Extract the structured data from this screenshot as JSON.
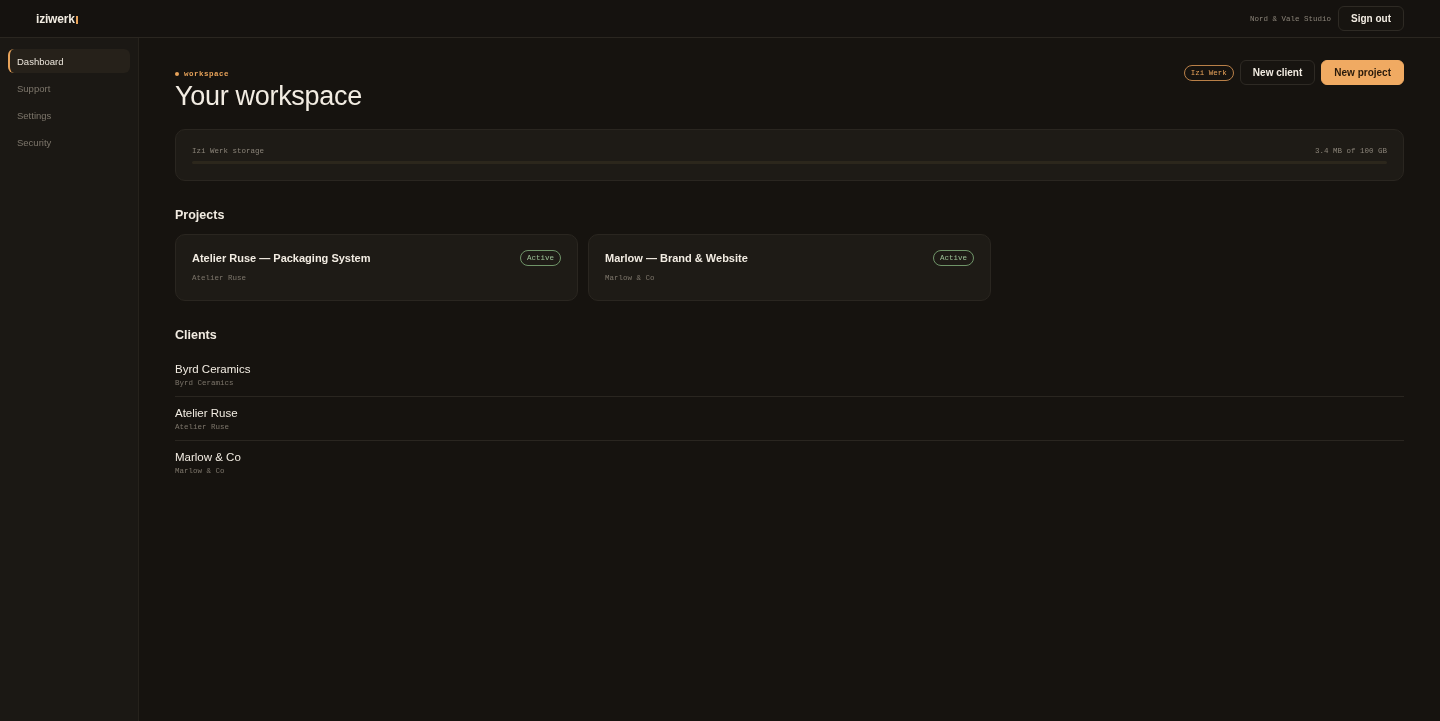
{
  "header": {
    "logo": "iziwerk",
    "studio": "Nord & Vale Studio",
    "sign_out": "Sign out"
  },
  "sidebar": {
    "items": [
      {
        "label": "Dashboard",
        "selected": true
      },
      {
        "label": "Support",
        "selected": false
      },
      {
        "label": "Settings",
        "selected": false
      },
      {
        "label": "Security",
        "selected": false
      }
    ]
  },
  "page": {
    "eyebrow": "workspace",
    "title": "Your workspace",
    "badge": "Izi Werk",
    "buttons": [
      {
        "label": "New client",
        "kind": "secondary"
      },
      {
        "label": "New project",
        "kind": "primary"
      }
    ]
  },
  "storage": {
    "label": "Izi Werk storage",
    "reading": "3.4 MB of 100 GB",
    "level": 0
  },
  "projects": {
    "heading": "Projects",
    "items": [
      {
        "title": "Atelier Ruse — Packaging System",
        "client": "Atelier Ruse",
        "status": "Active"
      },
      {
        "title": "Marlow — Brand & Website",
        "client": "Marlow & Co",
        "status": "Active"
      }
    ]
  },
  "clients": {
    "heading": "Clients",
    "items": [
      {
        "name": "Byrd Ceramics",
        "subtitle": "Byrd Ceramics"
      },
      {
        "name": "Atelier Ruse",
        "subtitle": "Atelier Ruse"
      },
      {
        "name": "Marlow & Co",
        "subtitle": "Marlow & Co"
      }
    ]
  }
}
